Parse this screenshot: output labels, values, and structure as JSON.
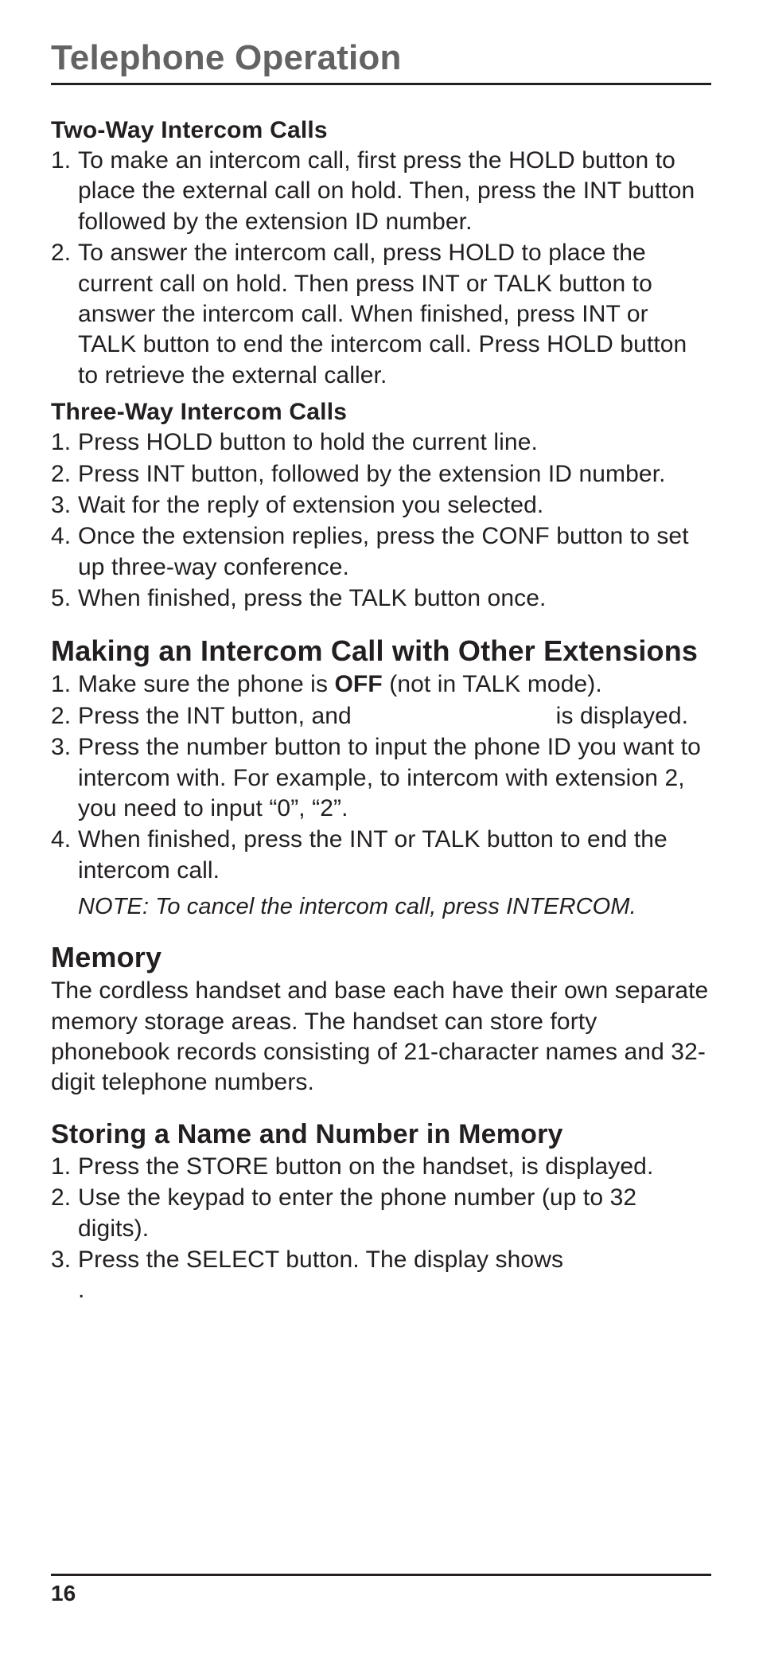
{
  "page_title": "Telephone Operation",
  "page_number": "16",
  "sections": {
    "two_way": {
      "heading": "Two-Way Intercom Calls",
      "items": [
        "To make an intercom call, first press the HOLD button to place the external call on hold. Then, press the INT button followed by the extension ID number.",
        "To answer the intercom call, press HOLD to place the current call on hold. Then press INT or TALK button to answer the intercom call. When finished, press INT or TALK button to end the intercom call. Press HOLD button to retrieve the external caller."
      ]
    },
    "three_way": {
      "heading": "Three-Way Intercom Calls",
      "items": [
        "Press HOLD button to hold the current line.",
        "Press INT button, followed by the extension ID number.",
        "Wait for the reply of extension you selected.",
        "Once the extension replies, press the CONF button to set up three-way conference.",
        "When finished, press the TALK button once."
      ]
    },
    "making": {
      "heading": "Making an Intercom Call with Other Extensions",
      "item1_pre": "Make sure the phone is ",
      "item1_bold": "OFF",
      "item1_post": " (not in TALK mode).",
      "item2_pre": "Press the INT button, and ",
      "item2_post": " is displayed.",
      "item3": "Press the number button to input the phone ID you want to intercom with. For example, to intercom with extension 2, you need to input “0”, “2”.",
      "item4": "When finished, press the INT or TALK button to end the intercom call.",
      "note": "NOTE: To cancel the intercom call, press INTERCOM."
    },
    "memory": {
      "heading": "Memory",
      "body": "The cordless handset and base each have their own separate memory storage areas. The handset can store forty phonebook records consisting of 21-character names and 32-digit telephone numbers."
    },
    "storing": {
      "heading": "Storing a Name and Number in Memory",
      "item1": "Press the STORE button on the handset, is displayed.",
      "item2": "Use the keypad to enter the phone number (up to 32 digits).",
      "item3_pre": "Press the SELECT button. The display shows ",
      "item3_post": "."
    }
  }
}
